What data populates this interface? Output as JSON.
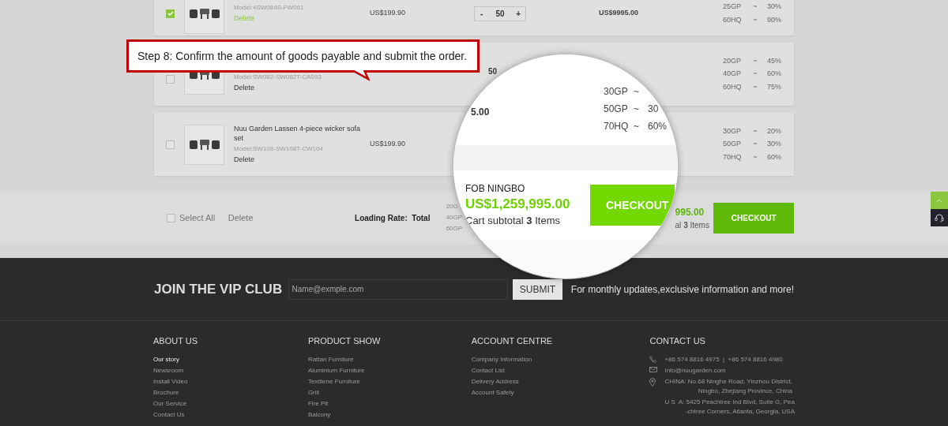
{
  "cart_rows": [
    {
      "checked": true,
      "model": "Model:4SW084S-FW091",
      "delete": "Delete",
      "price": "US$199.90",
      "quantity": {
        "minus": "-",
        "value": "50",
        "plus": "+"
      },
      "subtotal": "US$9995.00",
      "rates": [
        {
          "container": "25GP",
          "sep": "~",
          "percent": "30%"
        },
        {
          "container": "60HQ",
          "sep": "~",
          "percent": "90%"
        }
      ]
    },
    {
      "checked": false,
      "model": "Model:SW082-SW082T-CA093",
      "delete": "Delete",
      "quantity": {
        "value": "50"
      },
      "rates": [
        {
          "container": "20GP",
          "sep": "~",
          "percent": "45%"
        },
        {
          "container": "40GP",
          "sep": "~",
          "percent": "60%"
        },
        {
          "container": "60HQ",
          "sep": "~",
          "percent": "75%"
        }
      ]
    },
    {
      "checked": false,
      "name": "Nuu Garden Lassen 4-piece wicker sofa set",
      "model": "Model:SW108-SW108T-CW104",
      "delete": "Delete",
      "price": "US$199.90",
      "rates": [
        {
          "container": "30GP",
          "sep": "~",
          "percent": "20%"
        },
        {
          "container": "50GP",
          "sep": "~",
          "percent": "30%"
        },
        {
          "container": "70HQ",
          "sep": "~",
          "percent": "60%"
        }
      ]
    }
  ],
  "cart_footer": {
    "select_all": {
      "label": "Select All",
      "checked": false
    },
    "delete": "Delete",
    "loading_rate": "Loading Rate:  Total",
    "rates": [
      "20G",
      "40GP",
      "60GP"
    ],
    "total": "995.00",
    "items": "al **3** Items",
    "checkout": "CHECKOUT"
  },
  "tutorial_callout": {
    "text": "Step 8: Confirm the amount of goods payable and submit the order."
  },
  "magnifier": {
    "subtotal": "5.00",
    "rates": [
      {
        "container": "30GP",
        "sep": "~"
      },
      {
        "container": "50GP",
        "sep": "~",
        "percent": "30"
      },
      {
        "container": "70HQ",
        "sep": "~",
        "percent": "60%"
      }
    ],
    "shipping": "FOB NINGBO",
    "total": "US$1,259,995.00",
    "items": "Cart subtotal **3** Items",
    "checkout": "CHECKOUT"
  },
  "vip_club": {
    "title": "JOIN THE VIP CLUB",
    "placeholder": "Name@exmple.com",
    "submit": "SUBMIT",
    "note": "For monthly updates,exclusive information and more!"
  },
  "footer_columns": [
    {
      "heading": "ABOUT US",
      "links": [
        {
          "label": "Our story",
          "selected": true
        },
        {
          "label": "Newsroom",
          "selected": false
        },
        {
          "label": "Install Video",
          "selected": false
        },
        {
          "label": "Brochure",
          "selected": false
        },
        {
          "label": "Our Service",
          "selected": false
        },
        {
          "label": "Contact Us",
          "selected": false
        }
      ]
    },
    {
      "heading": "PRODUCT SHOW",
      "links": [
        {
          "label": "Rattan Furniture",
          "selected": false
        },
        {
          "label": "Aluminium Furniture",
          "selected": false
        },
        {
          "label": "Textilene Furniture",
          "selected": false
        },
        {
          "label": "Grill",
          "selected": false
        },
        {
          "label": "Fire Pit",
          "selected": false
        },
        {
          "label": "Balcony",
          "selected": false
        }
      ]
    },
    {
      "heading": "ACCOUNT CENTRE",
      "links": [
        {
          "label": "Company Information",
          "selected": false
        },
        {
          "label": "Contact List",
          "selected": false
        },
        {
          "label": "Delivery Address",
          "selected": false
        },
        {
          "label": "Account Safety",
          "selected": false
        }
      ]
    }
  ],
  "contact": {
    "heading": "CONTACT US",
    "items": [
      {
        "kind": "phone",
        "lines": [
          "+86 574 8816 4975  |  +86 574 8816 4980"
        ]
      },
      {
        "kind": "email",
        "lines": [
          "Info@nuugarden.com"
        ]
      },
      {
        "kind": "location",
        "lines": [
          "CHINA: No.68 Ninghe Road, Yinzhou District,",
          "Ningbo, Zhejiang Province, China"
        ]
      },
      {
        "kind": "plain",
        "lines": [
          "U S  A: 5425 Peachtree Ind Blvd, Suite G, Pea",
          "-chtree Corners, Atlanta, Georgia, USA"
        ]
      }
    ]
  }
}
